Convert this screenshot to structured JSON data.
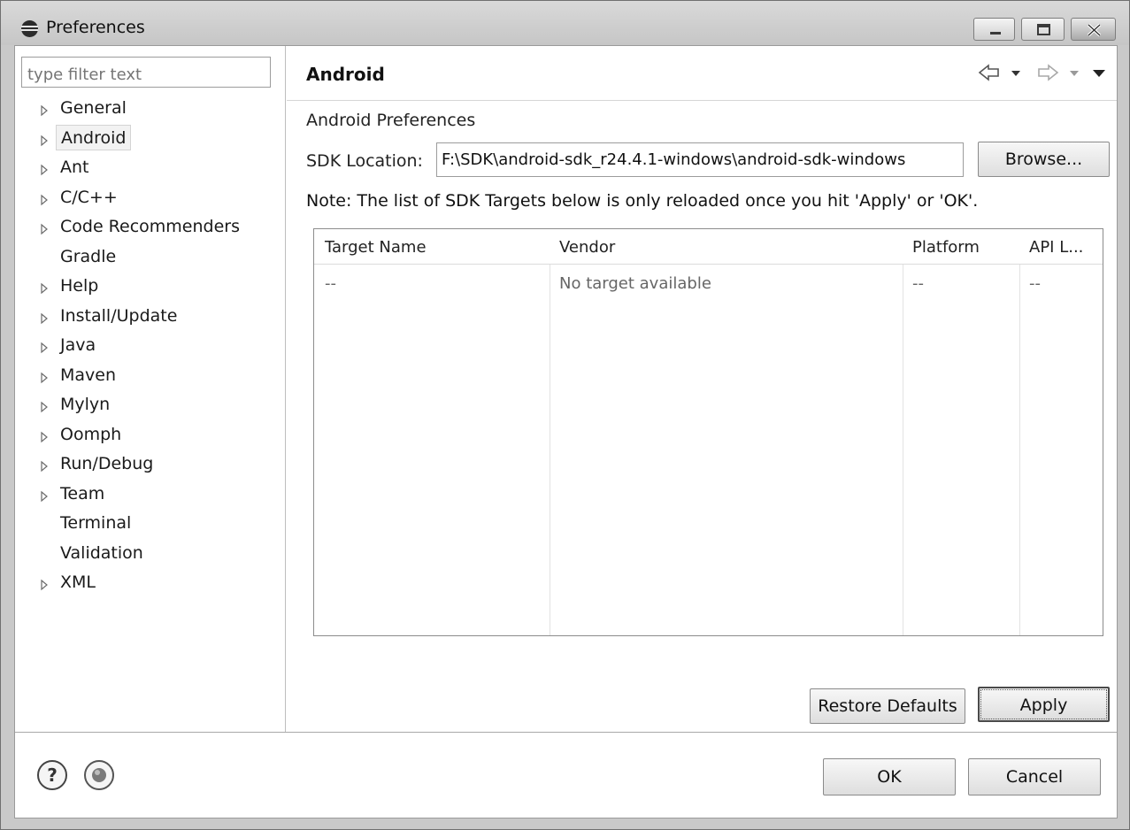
{
  "window": {
    "title": "Preferences",
    "controls": [
      "minimize-icon",
      "maximize-icon",
      "close-icon"
    ]
  },
  "sidebar": {
    "filter_placeholder": "type filter text",
    "items": [
      {
        "label": "General",
        "expandable": true
      },
      {
        "label": "Android",
        "expandable": true,
        "selected": true
      },
      {
        "label": "Ant",
        "expandable": true
      },
      {
        "label": "C/C++",
        "expandable": true
      },
      {
        "label": "Code Recommenders",
        "expandable": true
      },
      {
        "label": "Gradle",
        "expandable": false
      },
      {
        "label": "Help",
        "expandable": true
      },
      {
        "label": "Install/Update",
        "expandable": true
      },
      {
        "label": "Java",
        "expandable": true
      },
      {
        "label": "Maven",
        "expandable": true
      },
      {
        "label": "Mylyn",
        "expandable": true
      },
      {
        "label": "Oomph",
        "expandable": true
      },
      {
        "label": "Run/Debug",
        "expandable": true
      },
      {
        "label": "Team",
        "expandable": true
      },
      {
        "label": "Terminal",
        "expandable": false
      },
      {
        "label": "Validation",
        "expandable": false
      },
      {
        "label": "XML",
        "expandable": true
      }
    ]
  },
  "page": {
    "title": "Android",
    "nav_icons": [
      "back-arrow-icon",
      "dropdown-arrow-icon",
      "forward-arrow-icon",
      "dropdown-arrow-icon",
      "view-menu-icon"
    ],
    "section_label": "Android Preferences",
    "sdk_location_label": "SDK Location:",
    "sdk_location_value": "F:\\SDK\\android-sdk_r24.4.1-windows\\android-sdk-windows",
    "browse_label": "Browse...",
    "note": "Note: The list of SDK Targets below is only reloaded once you hit 'Apply' or 'OK'.",
    "table": {
      "columns": [
        "Target Name",
        "Vendor",
        "Platform",
        "API L..."
      ],
      "rows": [
        [
          "--",
          "No target available",
          "--",
          "--"
        ]
      ]
    },
    "restore_defaults_label": "Restore Defaults",
    "apply_label": "Apply"
  },
  "footer": {
    "icons": [
      "help-icon",
      "import-export-icon"
    ],
    "ok_label": "OK",
    "cancel_label": "Cancel"
  }
}
